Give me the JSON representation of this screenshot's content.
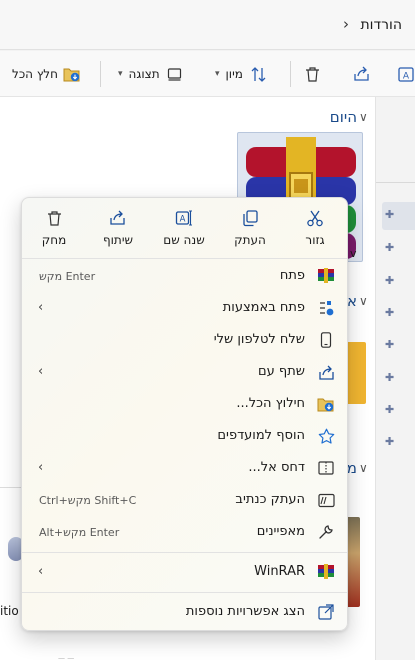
{
  "address_bar": {
    "title": "הורדות",
    "chevron": "›"
  },
  "toolbar": {
    "extract_all": "חלץ הכל",
    "view": "תצוגה",
    "sort": "מיון"
  },
  "groups": {
    "today": "היום",
    "second_partial": "א",
    "third_partial": "מ"
  },
  "file_labels": {
    "partial_name": "v",
    "left_partial": "itio",
    "bottom_left": "— —"
  },
  "context_menu": {
    "quick_actions": [
      {
        "label": "גזור",
        "icon": "scissors-icon"
      },
      {
        "label": "העתק",
        "icon": "copy-icon"
      },
      {
        "label": "שנה שם",
        "icon": "rename-icon"
      },
      {
        "label": "שיתוף",
        "icon": "share-icon"
      },
      {
        "label": "מחק",
        "icon": "trash-icon"
      }
    ],
    "items": [
      {
        "label": "פתח",
        "shortcut": "מקש Enter",
        "icon": "winrar-icon"
      },
      {
        "label": "פתח באמצעות",
        "submenu": "‹",
        "icon": "open-with-icon"
      },
      {
        "label": "שלח לטלפון שלי",
        "icon": "phone-icon"
      },
      {
        "label": "שתף עם",
        "submenu": "‹",
        "icon": "share-with-icon"
      },
      {
        "label": "חילוץ הכל...",
        "icon": "extract-all-icon"
      },
      {
        "label": "הוסף למועדפים",
        "icon": "star-icon"
      },
      {
        "label": "דחס אל...",
        "submenu": "‹",
        "icon": "compress-icon"
      },
      {
        "label": "העתק כנתיב",
        "shortcut": "Ctrl+מקש Shift+C",
        "icon": "copy-path-icon"
      },
      {
        "label": "מאפיינים",
        "shortcut": "Alt+מקש Enter",
        "icon": "properties-icon"
      }
    ],
    "winrar": {
      "label": "WinRAR",
      "submenu": "‹",
      "icon": "winrar-icon"
    },
    "more": {
      "label": "הצג אפשרויות נוספות",
      "icon": "more-options-icon"
    }
  },
  "colors": {
    "accent": "#0067c0",
    "group_header": "#1a4a8a"
  }
}
